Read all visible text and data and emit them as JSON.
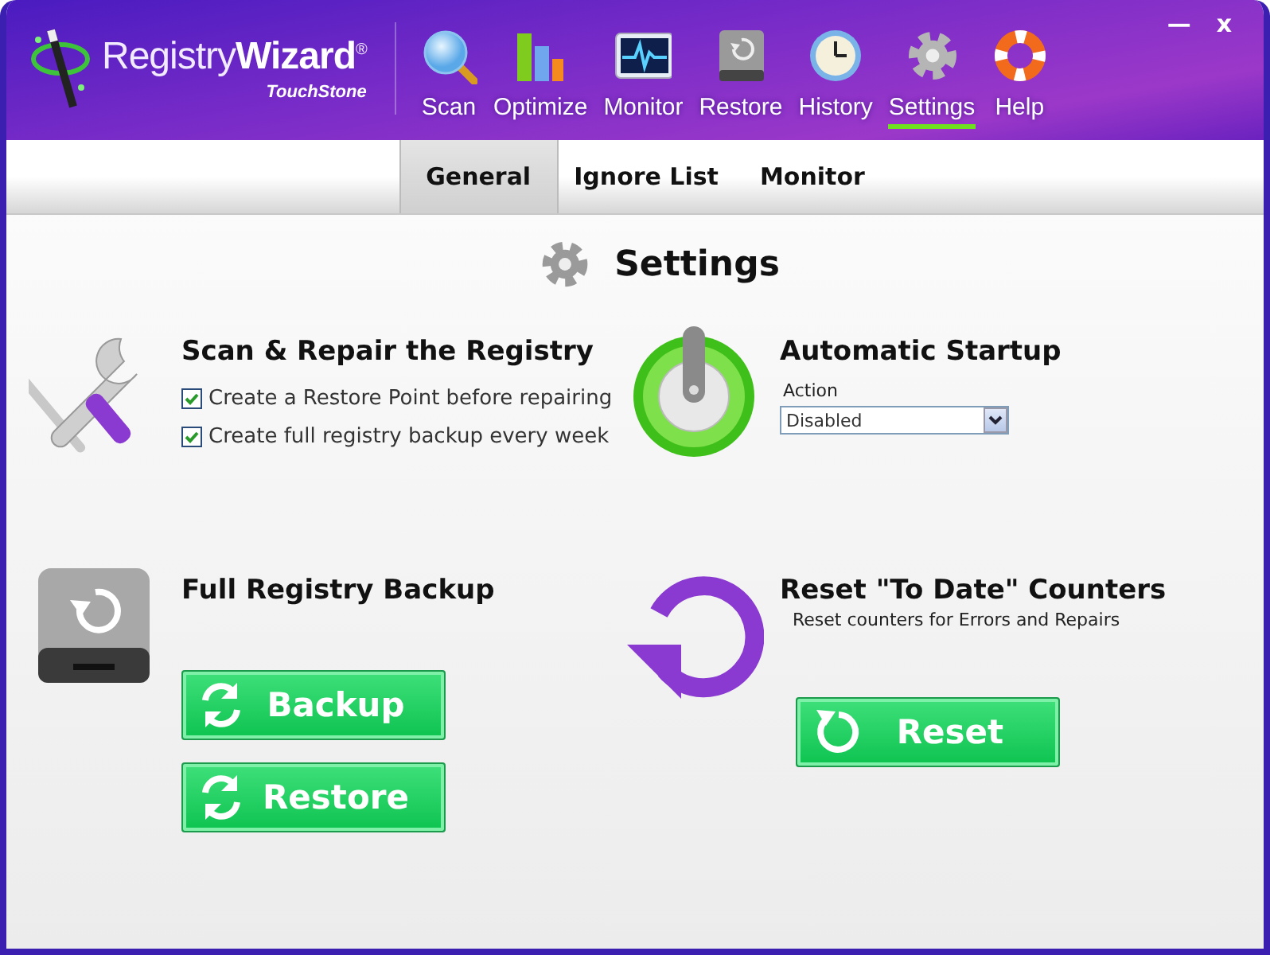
{
  "logo": {
    "name": "Registry**Wizard**$^{®}$",
    "vendor": "TouchStone"
  },
  "nav": [
    {
      "kind": "scan",
      "label": "Scan",
      "selected": false
    },
    {
      "kind": "optimize",
      "label": "Optimize",
      "selected": false
    },
    {
      "kind": "monitor",
      "label": "Monitor",
      "selected": false
    },
    {
      "kind": "restore",
      "label": "Restore",
      "selected": false
    },
    {
      "kind": "history",
      "label": "History",
      "selected": false
    },
    {
      "kind": "settings",
      "label": "Settings",
      "selected": true
    },
    {
      "kind": "help",
      "label": "Help",
      "selected": false
    }
  ],
  "window_controls": [
    "—",
    "x"
  ],
  "tabs": [
    {
      "label": "General",
      "selected": true
    },
    {
      "label": "Ignore List",
      "selected": false
    },
    {
      "label": "Monitor",
      "selected": false
    }
  ],
  "page_title": "Settings",
  "sections": [
    {
      "kind": "repair",
      "title": "Scan & Repair the Registry",
      "options": [
        {
          "label": "Create a Restore Point before repairing",
          "checked": true
        },
        {
          "label": "Create full registry backup every week",
          "checked": true
        }
      ]
    },
    {
      "kind": "startup",
      "title": "Automatic Startup",
      "field_label": "Action",
      "value": "Disabled"
    },
    {
      "kind": "backup",
      "title": "Full Registry Backup",
      "buttons": [
        {
          "kind": "sync",
          "label": "Backup"
        },
        {
          "kind": "sync",
          "label": "Restore"
        }
      ]
    },
    {
      "kind": "reset",
      "title": "Reset \"To Date\" Counters",
      "description": "Reset counters for Errors and Repairs",
      "buttons": [
        {
          "kind": "reload",
          "label": "Reset"
        }
      ]
    }
  ]
}
